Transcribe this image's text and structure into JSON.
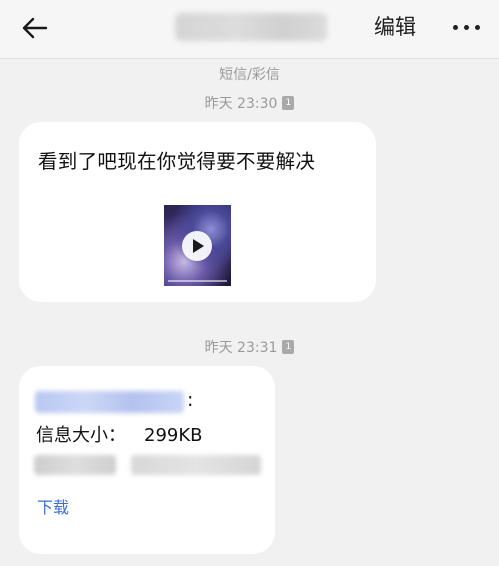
{
  "topbar": {
    "back_icon": "arrow-left-icon",
    "edit_label": "编辑",
    "more_icon": "more-horizontal-icon"
  },
  "conversation": {
    "channel_label": "短信/彩信",
    "sim_badge": "1"
  },
  "messages": [
    {
      "time": "昨天 23:30",
      "text": "看到了吧现在你觉得要不要解决",
      "attachment": {
        "type": "video",
        "icon": "play-icon"
      }
    },
    {
      "time": "昨天 23:31",
      "colon": ":",
      "size_label": "信息大小：",
      "size_value": "299KB",
      "download_label": "下载"
    }
  ],
  "colors": {
    "background": "#f1f1f1",
    "bubble": "#ffffff",
    "meta_text": "#9a9a9a",
    "link": "#3c6fd6"
  }
}
